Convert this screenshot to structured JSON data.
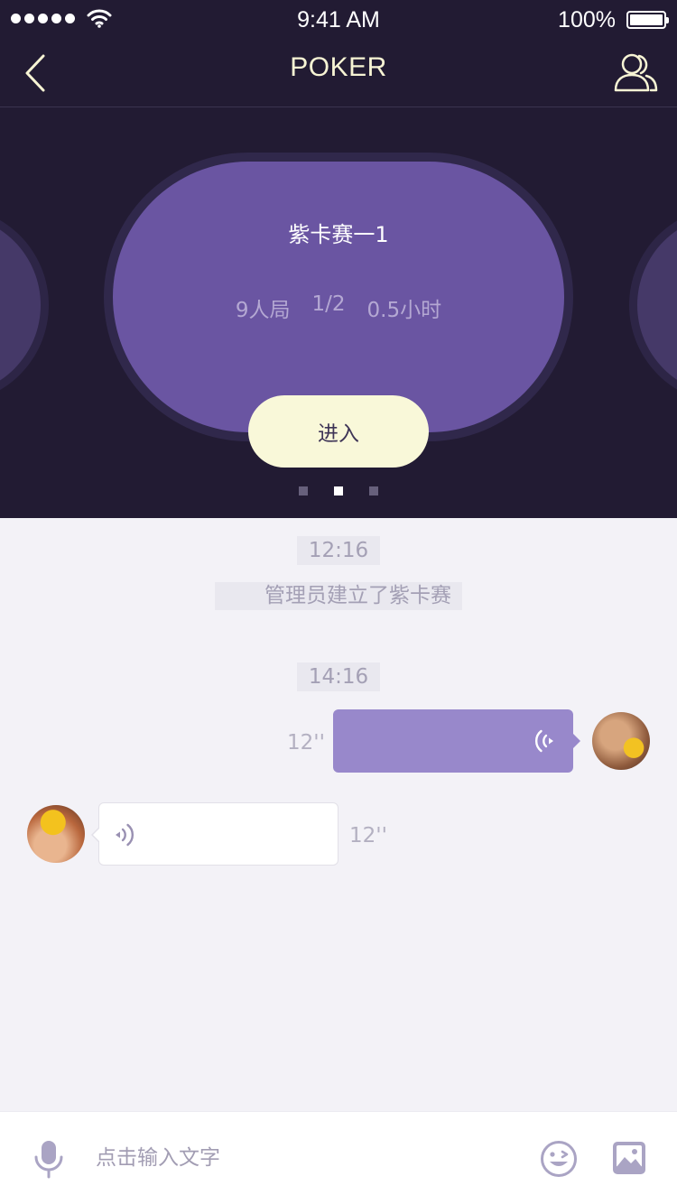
{
  "status_bar": {
    "time": "9:41 AM",
    "battery": "100%"
  },
  "nav": {
    "title": "POKER"
  },
  "carousel": {
    "table_name": "紫卡赛一1",
    "info": [
      "9人局",
      "1/2",
      "0.5小时"
    ],
    "enter_label": "进入",
    "page_count": 3,
    "active_page": 2
  },
  "chat": {
    "system_block": {
      "time": "12:16",
      "text": "管理员建立了紫卡赛"
    },
    "voice_block": {
      "time": "14:16"
    },
    "messages": [
      {
        "direction": "outgoing",
        "type": "voice",
        "duration": "12''"
      },
      {
        "direction": "incoming",
        "type": "voice",
        "duration": "12''"
      }
    ]
  },
  "input_bar": {
    "placeholder": "点击输入文字",
    "icons": [
      "microphone-icon",
      "emoji-icon",
      "image-icon"
    ]
  },
  "colors": {
    "header_bg": "#221b33",
    "table_felt": "#6a55a2",
    "enter_button": "#f9f8d9",
    "outgoing_bubble": "#9888cb",
    "chat_bg": "#f3f2f7"
  }
}
